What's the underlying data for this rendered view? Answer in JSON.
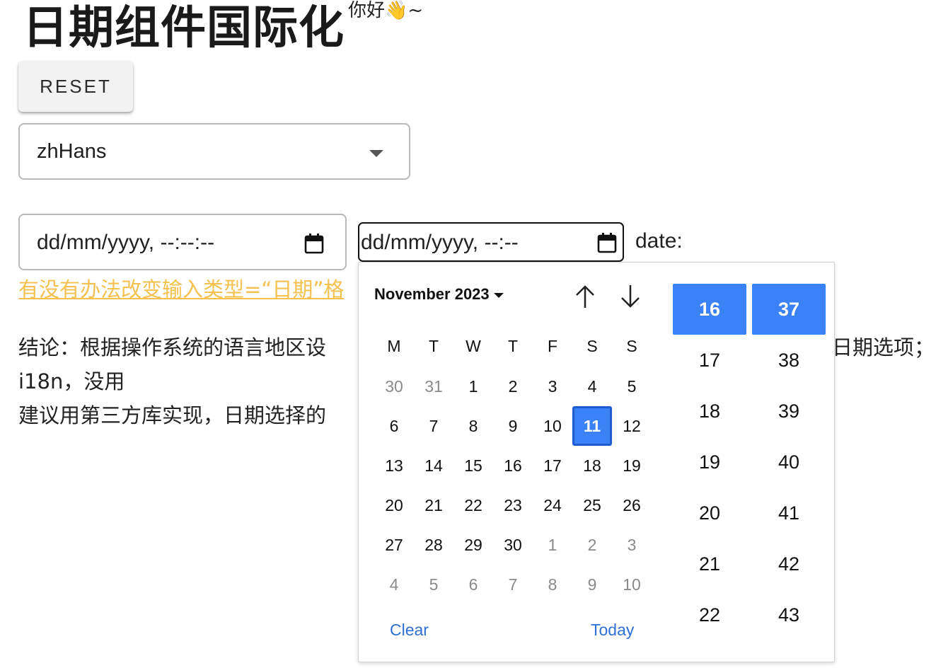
{
  "title": "日期组件国际化",
  "greeting": "你好👋~",
  "reset_label": "RESET",
  "locale_value": "zhHans",
  "datetime_placeholder": "dd/mm/yyyy, --:--:--",
  "datetime_local_placeholder": "dd/mm/yyyy, --:--",
  "date_label": "date:",
  "link_text": "有没有办法改变输入类型=“日期”格",
  "paragraph": {
    "line1": "结论：根据操作系统的语言地区设",
    "line1_tail": "日期选项；",
    "line2": "i18n，没用",
    "line3": "建议用第三方库实现，日期选择的"
  },
  "picker": {
    "month_label": "November 2023",
    "weekdays": [
      "M",
      "T",
      "W",
      "T",
      "F",
      "S",
      "S"
    ],
    "weeks": [
      [
        "30",
        "31",
        "1",
        "2",
        "3",
        "4",
        "5"
      ],
      [
        "6",
        "7",
        "8",
        "9",
        "10",
        "11",
        "12"
      ],
      [
        "13",
        "14",
        "15",
        "16",
        "17",
        "18",
        "19"
      ],
      [
        "20",
        "21",
        "22",
        "23",
        "24",
        "25",
        "26"
      ],
      [
        "27",
        "28",
        "29",
        "30",
        "1",
        "2",
        "3"
      ],
      [
        "4",
        "5",
        "6",
        "7",
        "8",
        "9",
        "10"
      ]
    ],
    "muted": [
      [
        true,
        true,
        false,
        false,
        false,
        false,
        false
      ],
      [
        false,
        false,
        false,
        false,
        false,
        false,
        false
      ],
      [
        false,
        false,
        false,
        false,
        false,
        false,
        false
      ],
      [
        false,
        false,
        false,
        false,
        false,
        false,
        false
      ],
      [
        false,
        false,
        false,
        false,
        true,
        true,
        true
      ],
      [
        true,
        true,
        true,
        true,
        true,
        true,
        true
      ]
    ],
    "selected_day": "11",
    "clear_label": "Clear",
    "today_label": "Today",
    "hours": [
      "16",
      "17",
      "18",
      "19",
      "20",
      "21",
      "22"
    ],
    "minutes": [
      "37",
      "38",
      "39",
      "40",
      "41",
      "42",
      "43"
    ],
    "selected_hour": "16",
    "selected_minute": "37",
    "accent_color": "#3b82f6",
    "link_color": "#2f6fd6"
  },
  "colors": {
    "link": "#f4c14f",
    "button_bg": "#f2f2f2"
  },
  "icons": {
    "calendar": "calendar-icon",
    "up": "arrow-up-icon",
    "down": "arrow-down-icon",
    "dropdown": "caret-down-icon"
  }
}
